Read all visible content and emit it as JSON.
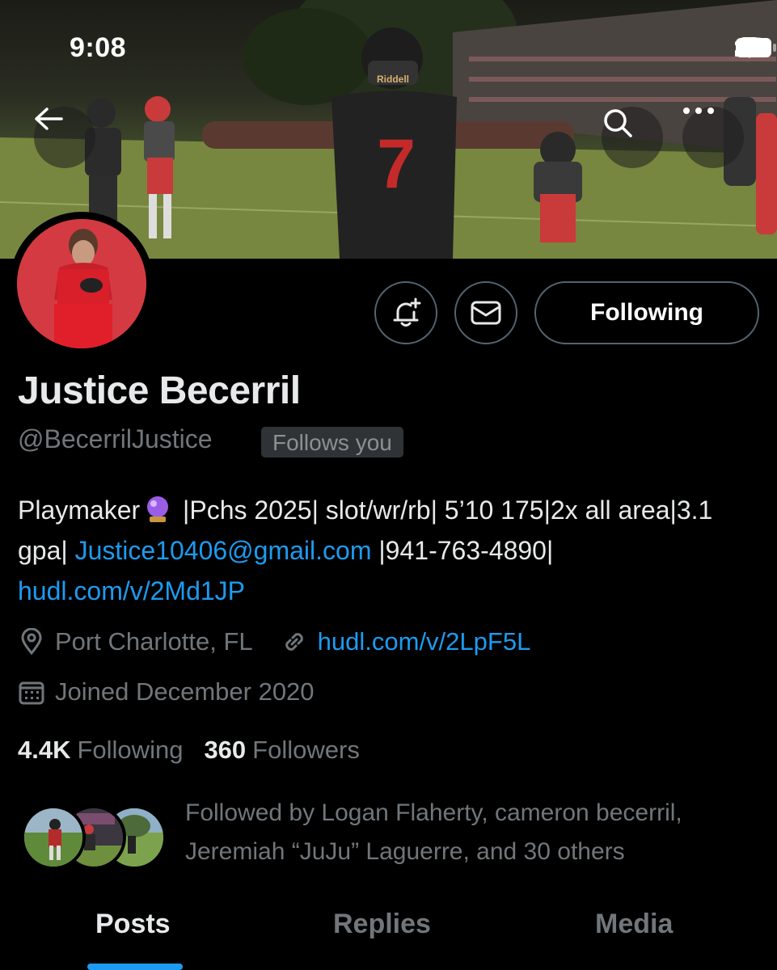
{
  "status_bar": {
    "time": "9:08",
    "icons": [
      "signal-icon",
      "wifi-icon",
      "battery-icon"
    ]
  },
  "header": {
    "back_icon": "arrow-left-icon",
    "search_icon": "search-icon",
    "more_icon": "ellipsis-icon",
    "banner_jersey_number": "7",
    "banner_helmet_text": "Riddell"
  },
  "actions": {
    "notify_icon": "bell-plus-icon",
    "message_icon": "envelope-icon",
    "following_label": "Following"
  },
  "profile": {
    "display_name": "Justice Becerril",
    "handle": "@BecerrilJustice",
    "follows_you_badge": "Follows you",
    "bio": {
      "part1": "Playmaker",
      "emoji": "crystal-ball-emoji",
      "part2": " |Pchs 2025| slot/wr/rb| 5’10 175|2x all area|3.1 gpa| ",
      "email": "Justice10406@gmail.com",
      "part3": " |941-763-4890|",
      "link": "hudl.com/v/2Md1JP"
    },
    "location": "Port Charlotte, FL",
    "website": "hudl.com/v/2LpF5L",
    "joined": "Joined December 2020",
    "following_count": "4.4K",
    "following_label": "Following",
    "followers_count": "360",
    "followers_label": "Followers",
    "followed_by_line1": "Followed by Logan Flaherty, cameron becerril,",
    "followed_by_line2": "Jeremiah “JuJu” Laguerre, and 30 others"
  },
  "tabs": [
    {
      "label": "Posts",
      "active": true
    },
    {
      "label": "Replies",
      "active": false
    },
    {
      "label": "Media",
      "active": false
    }
  ],
  "colors": {
    "background": "#000000",
    "link": "#1d9bf0",
    "muted": "#71767b",
    "text": "#e7e9ea",
    "border": "#536471"
  }
}
